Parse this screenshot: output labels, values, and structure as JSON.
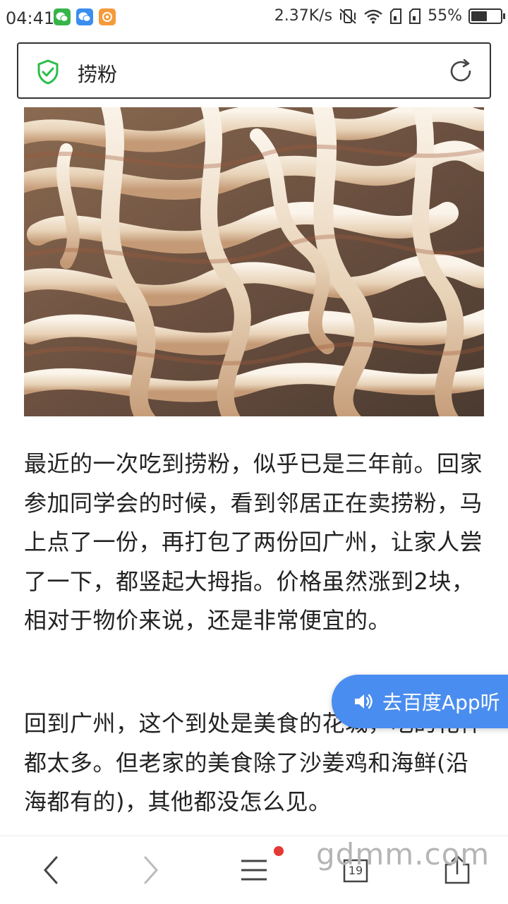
{
  "status_bar": {
    "time": "04:41",
    "network_speed": "2.37K/s",
    "battery": "55%",
    "battery_level": 0.55,
    "left_icons": [
      "wechat-icon",
      "chat-icon",
      "mail-app-icon"
    ],
    "right_icons": [
      "mute-vibrate-icon",
      "wifi-icon",
      "sim1-icon",
      "sim2-icon",
      "battery-icon"
    ]
  },
  "search": {
    "query": "捞粉",
    "shield_color": "#2bbd4a"
  },
  "article": {
    "paragraph1": "最近的一次吃到捞粉，似乎已是三年前。回家参加同学会的时候，看到邻居正在卖捞粉，马上点了一份，再打包了两份回广州，让家人尝了一下，都竖起大拇指。价格虽然涨到2块，相对于物价来说，还是非常便宜的。",
    "paragraph2": "回到广州，这个到处是美食的花城，吃的花样都太多。但老家的美食除了沙姜鸡和海鲜(沿海都有的)，其他都没怎么见。"
  },
  "listen_button": {
    "label": "去百度App听",
    "color": "#4a8df0"
  },
  "toolbar": {
    "tabs_count": "19",
    "watermark": "gdmm.com"
  }
}
